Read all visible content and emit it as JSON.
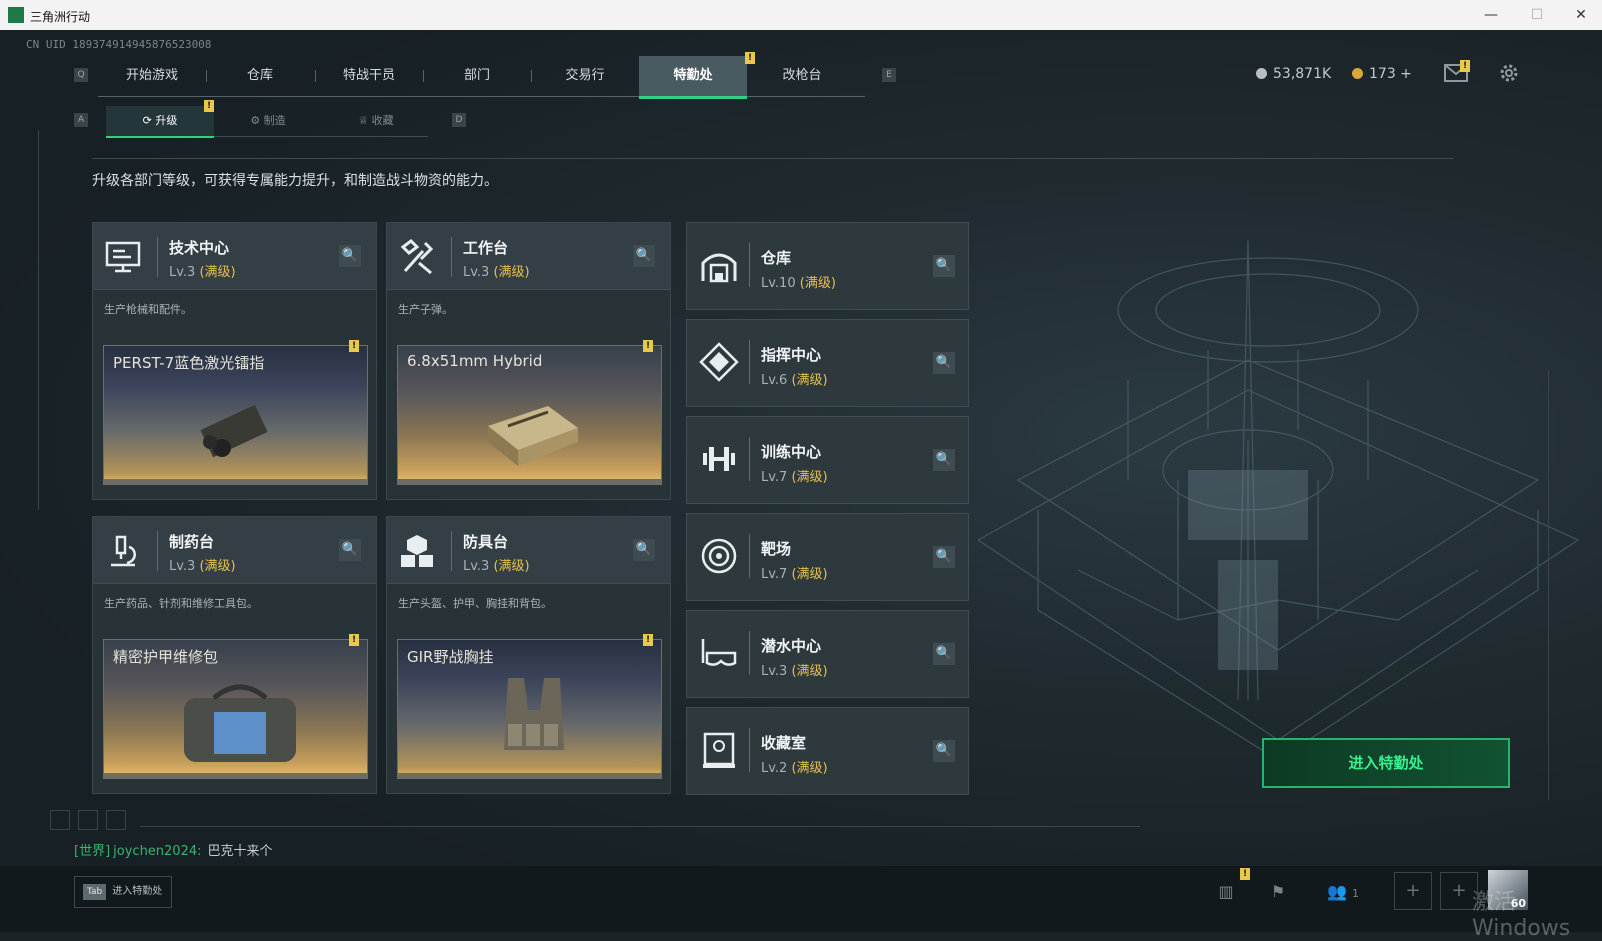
{
  "window": {
    "title": "三角洲行动",
    "minimize": "—",
    "maximize": "☐",
    "close": "✕"
  },
  "uid": "CN UID 1893749149458765230​08",
  "main_tabs": [
    "开始游戏",
    "仓库",
    "特战干员",
    "部门",
    "交易行",
    "特勤处",
    "改枪台"
  ],
  "main_tabs_active": "特勤处",
  "key_hints": {
    "left": "Q",
    "right": "E",
    "sub_left": "A",
    "sub_right": "D"
  },
  "alert_symbol": "!",
  "currency": {
    "money": "53,871K",
    "coins": "173 +"
  },
  "colors": {
    "accent": "#31d083",
    "max_level": "#e5c04f",
    "alert": "#e9c94b"
  },
  "sub_tabs": [
    {
      "label": "升级",
      "icon": "upgrade-icon"
    },
    {
      "label": "制造",
      "icon": "gear-icon"
    },
    {
      "label": "收藏",
      "icon": "trophy-icon"
    }
  ],
  "description": "升级各部门等级，可获得专属能力提升，和制造战斗物资的能力。",
  "big_cards": [
    {
      "name": "技术中心",
      "level": "Lv.3",
      "status": "(满级)",
      "desc": "生产枪械和配件。",
      "item": "PERST-7蓝色激光镭指",
      "icon": "computer-icon"
    },
    {
      "name": "工作台",
      "level": "Lv.3",
      "status": "(满级)",
      "desc": "生产子弹。",
      "item": "6.8x51mm Hybrid",
      "icon": "tools-icon"
    },
    {
      "name": "制药台",
      "level": "Lv.3",
      "status": "(满级)",
      "desc": "生产药品、针剂和维修工具包。",
      "item": "精密护甲维修包",
      "icon": "microscope-icon"
    },
    {
      "name": "防具台",
      "level": "Lv.3",
      "status": "(满级)",
      "desc": "生产头盔、护甲、胸挂和背包。",
      "item": "GIR野战胸挂",
      "icon": "cubes-icon"
    }
  ],
  "facilities": [
    {
      "name": "仓库",
      "level": "Lv.10",
      "status": "(满级)",
      "icon": "warehouse-icon"
    },
    {
      "name": "指挥中心",
      "level": "Lv.6",
      "status": "(满级)",
      "icon": "command-icon"
    },
    {
      "name": "训练中心",
      "level": "Lv.7",
      "status": "(满级)",
      "icon": "dumbbell-icon"
    },
    {
      "name": "靶场",
      "level": "Lv.7",
      "status": "(满级)",
      "icon": "target-icon"
    },
    {
      "name": "潜水中心",
      "level": "Lv.3",
      "status": "(满级)",
      "icon": "diving-mask-icon"
    },
    {
      "name": "收藏室",
      "level": "Lv.2",
      "status": "(满级)",
      "icon": "trophy-case-icon"
    }
  ],
  "enter_button": "进入特勤处",
  "chat": {
    "channel": "[世界]",
    "user": "joychen2024:",
    "message": "巴克十来个"
  },
  "bottom": {
    "tab_key": "Tab",
    "tab_hint": "进入特勤处",
    "friends_count": "1",
    "player_level": "60",
    "watermark": "激活 Windows"
  }
}
